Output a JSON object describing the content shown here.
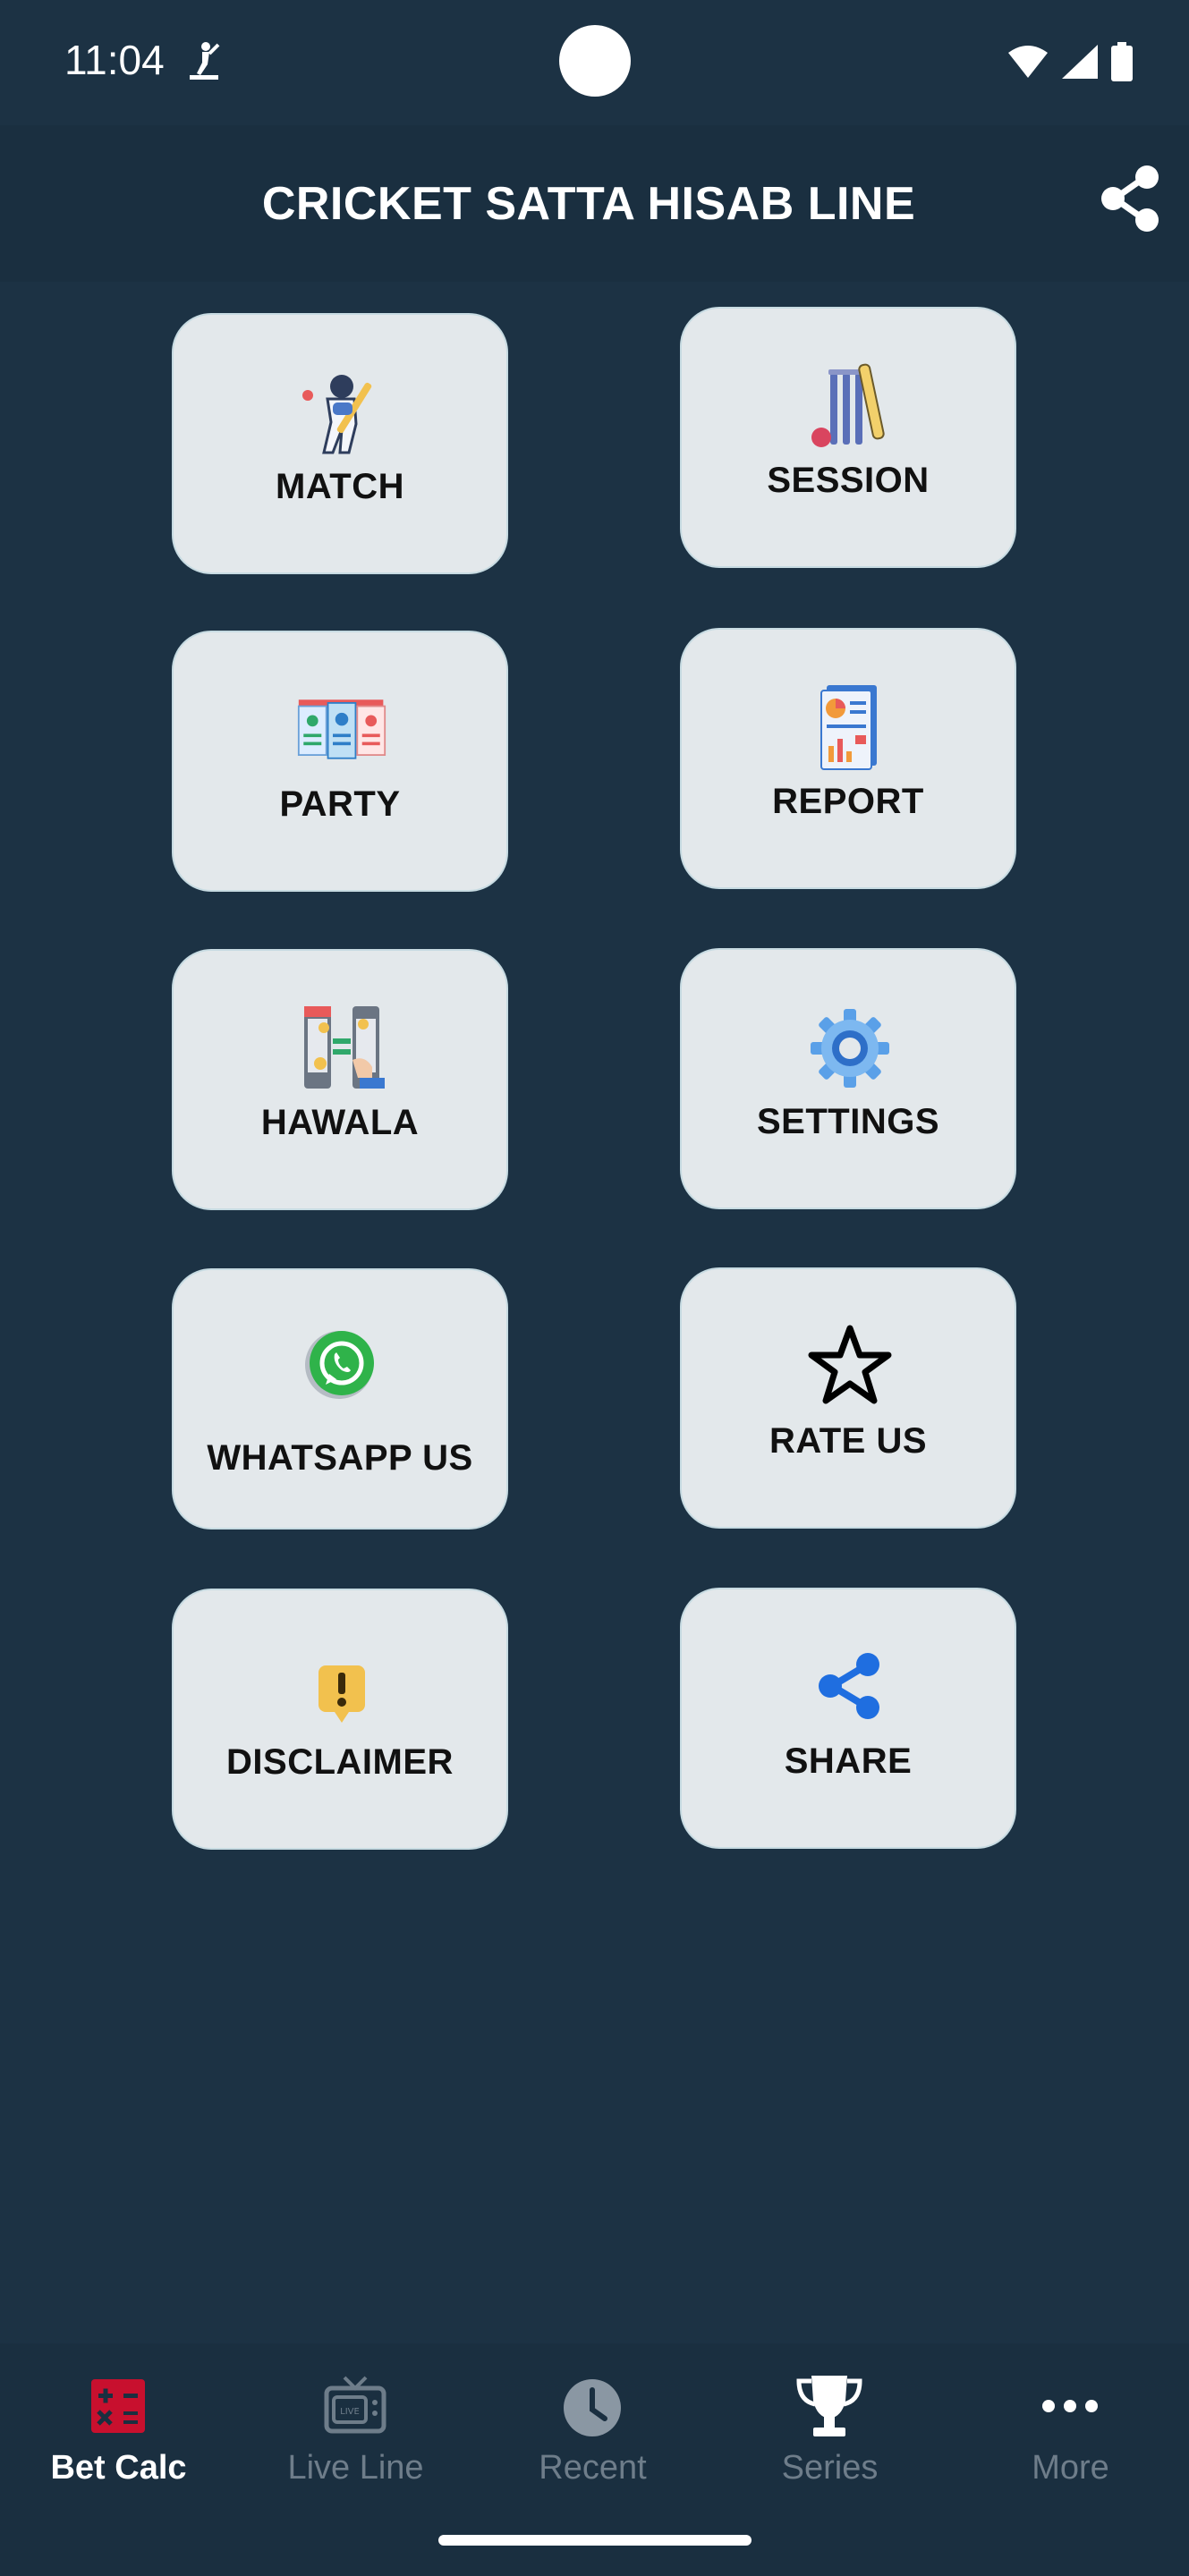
{
  "status_bar": {
    "time": "11:04"
  },
  "header": {
    "title": "CRICKET SATTA HISAB LINE",
    "share_icon": "share-icon"
  },
  "tiles": [
    {
      "label": "MATCH",
      "icon": "batsman-icon"
    },
    {
      "label": "SESSION",
      "icon": "stumps-bat-icon"
    },
    {
      "label": "PARTY",
      "icon": "party-cards-icon"
    },
    {
      "label": "REPORT",
      "icon": "report-icon"
    },
    {
      "label": "HAWALA",
      "icon": "money-transfer-icon"
    },
    {
      "label": "SETTINGS",
      "icon": "gear-icon"
    },
    {
      "label": "WHATSAPP US",
      "icon": "whatsapp-icon"
    },
    {
      "label": "RATE US",
      "icon": "star-icon"
    },
    {
      "label": "DISCLAIMER",
      "icon": "warning-icon"
    },
    {
      "label": "SHARE",
      "icon": "share-icon"
    }
  ],
  "bottom_nav": [
    {
      "label": "Bet Calc",
      "icon": "calculator-icon",
      "active": true
    },
    {
      "label": "Live Line",
      "icon": "live-tv-icon",
      "active": false
    },
    {
      "label": "Recent",
      "icon": "clock-icon",
      "active": false
    },
    {
      "label": "Series",
      "icon": "trophy-icon",
      "active": false
    },
    {
      "label": "More",
      "icon": "more-dots-icon",
      "active": false
    }
  ],
  "colors": {
    "background": "#1c3244",
    "header": "#1a2f40",
    "tile": "#e3e8eb",
    "active_nav": "#ffffff",
    "inactive_nav": "#6e7d8a",
    "accent_red": "#c8102e"
  }
}
